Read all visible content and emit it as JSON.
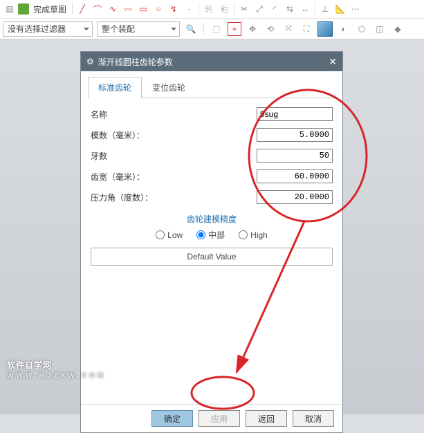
{
  "toolbar": {
    "sketch_done": "完成草图",
    "filter_placeholder": "没有选择过滤器",
    "assembly_placeholder": "整个装配"
  },
  "dialog": {
    "title": "渐开线圆柱齿轮参数",
    "tabs": {
      "standard": "标准齿轮",
      "shifted": "变位齿轮"
    },
    "labels": {
      "name": "名称",
      "module": "模数（毫米）：",
      "teeth": "牙数",
      "width": "齿宽（毫米）：",
      "pressure": "压力角（度数）："
    },
    "values": {
      "name": "9sug",
      "module": "5.0000",
      "teeth": "50",
      "width": "60.0000",
      "pressure": "20.0000"
    },
    "precision_title": "齿轮建模精度",
    "precision": {
      "low": "Low",
      "mid": "中部",
      "high": "High"
    },
    "default_btn": "Default Value",
    "buttons": {
      "ok": "确定",
      "apply": "应用",
      "back": "返回",
      "cancel": "取消"
    }
  },
  "watermark": {
    "main": "软件自学网",
    "sub": "WWW.RJZXW.COM"
  }
}
